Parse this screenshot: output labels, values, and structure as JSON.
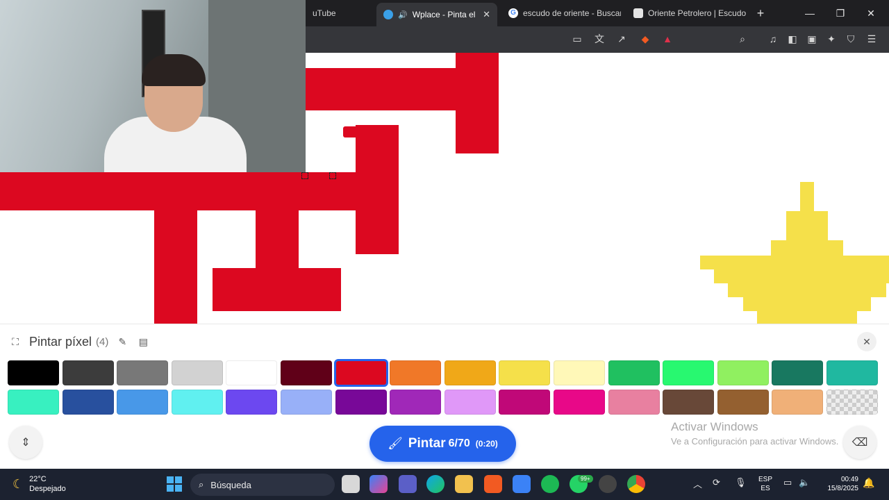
{
  "browser": {
    "tabs": [
      {
        "label": "uTube",
        "active": false
      },
      {
        "label": "Wplace - Pinta el m",
        "active": true,
        "audio": true
      },
      {
        "label": "escudo de oriente - Buscar",
        "active": false
      },
      {
        "label": "Oriente Petrolero | Escudo",
        "active": false
      }
    ],
    "window": {
      "minimize": "—",
      "maximize": "❐",
      "close": "✕"
    },
    "new_tab": "+",
    "tab_close": "✕"
  },
  "panel": {
    "title": "Pintar píxel",
    "count": "(4)",
    "close": "✕",
    "selected_color": "#dc0820",
    "palette": [
      "#000000",
      "#3c3c3c",
      "#787878",
      "#d2d2d2",
      "#ffffff",
      "#600018",
      "#dc0820",
      "#f07828",
      "#f0a818",
      "#f5e04a",
      "#fff8b8",
      "#20c060",
      "#28f870",
      "#90f060",
      "#187860",
      "#20b8a0",
      "#38f0c0",
      "#28509e",
      "#4898e8",
      "#60f0f0",
      "#6c48f0",
      "#98b0f8",
      "#780898",
      "#a028b8",
      "#e098f8",
      "#c00878",
      "#e80888",
      "#e880a0",
      "#684838",
      "#946030",
      "#f0b078",
      "transparent"
    ],
    "paint_button": {
      "label": "Pintar",
      "count": "6/70",
      "time": "(0:20)"
    },
    "watermark": {
      "line1": "Activar Windows",
      "line2": "Ve a Configuración para activar Windows."
    }
  },
  "taskbar": {
    "weather": {
      "temp": "22°C",
      "desc": "Despejado"
    },
    "search_placeholder": "Búsqueda",
    "badge": "99+",
    "lang": {
      "top": "ESP",
      "bottom": "ES"
    },
    "clock": {
      "time": "00:49",
      "date": "15/8/2025"
    }
  },
  "colors": {
    "accent": "#2563eb",
    "red": "#dc0820",
    "yellow": "#f5e04a"
  }
}
